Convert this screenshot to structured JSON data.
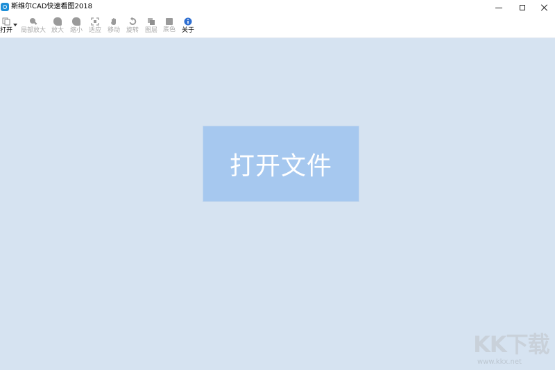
{
  "window": {
    "title": "斯维尔CAD快速看图2018",
    "controls": {
      "minimize": "minimize-icon",
      "maximize": "maximize-icon",
      "close": "close-icon"
    }
  },
  "toolbar": {
    "items": [
      {
        "label": "打开",
        "icon": "open-file-icon",
        "enabled": true,
        "has_dropdown": true
      },
      {
        "label": "局部放大",
        "icon": "zoom-window-icon",
        "enabled": false
      },
      {
        "label": "放大",
        "icon": "zoom-in-icon",
        "enabled": false
      },
      {
        "label": "缩小",
        "icon": "zoom-out-icon",
        "enabled": false
      },
      {
        "label": "适应",
        "icon": "fit-view-icon",
        "enabled": false
      },
      {
        "label": "移动",
        "icon": "pan-hand-icon",
        "enabled": false
      },
      {
        "label": "旋转",
        "icon": "rotate-icon",
        "enabled": false
      },
      {
        "label": "图层",
        "icon": "layers-icon",
        "enabled": false
      },
      {
        "label": "底色",
        "icon": "background-color-icon",
        "enabled": false
      },
      {
        "label": "关于",
        "icon": "info-icon",
        "enabled": true
      }
    ]
  },
  "main": {
    "open_file_button": "打开文件",
    "background_color": "#d6e3f1",
    "button_color": "#a6c8ef"
  },
  "watermark": {
    "logo": "KK下载",
    "url": "www.kkx.net"
  }
}
